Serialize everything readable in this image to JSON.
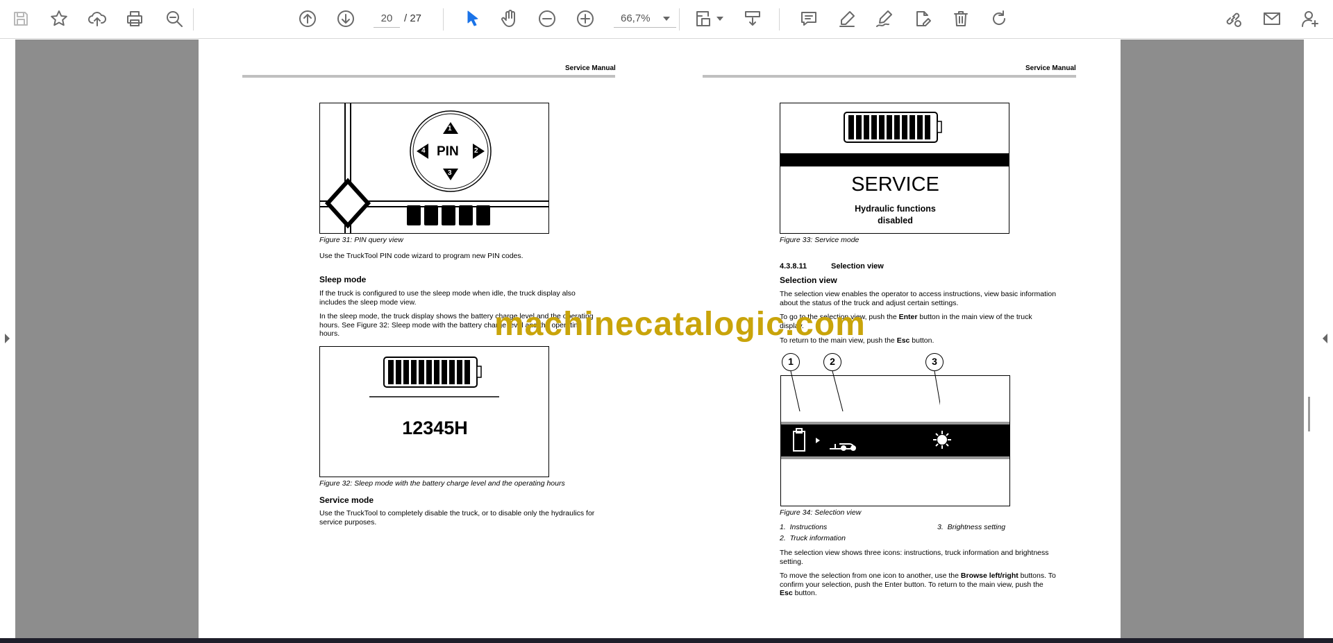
{
  "toolbar": {
    "page_current": "20",
    "page_total": "/  27",
    "zoom": "66,7%"
  },
  "watermark": "machinecatalogic.com",
  "left_page": {
    "header": "Service Manual",
    "fig31": {
      "pin": "PIN",
      "num1": "1",
      "num2": "2",
      "num3": "3",
      "num4": "4",
      "caption": "Figure 31: PIN query view"
    },
    "para1": "Use the TruckTool PIN code wizard to program new PIN codes.",
    "sleep_heading": "Sleep mode",
    "sleep_p1": "If the truck is configured to use the sleep mode when idle, the truck display also includes the sleep mode view.",
    "sleep_p2": "In the sleep mode, the truck display shows the battery charge level and the operating hours. See Figure 32: Sleep mode with the battery charge level and the operating hours.",
    "fig32": {
      "hours": "12345H",
      "caption": "Figure 32: Sleep mode with the battery charge level and the operating hours"
    },
    "service_heading": "Service mode",
    "service_p": "Use the TruckTool to completely disable the truck, or to disable only the hydraulics for service purposes."
  },
  "right_page": {
    "header": "Service Manual",
    "fig33": {
      "service": "SERVICE",
      "line1": "Hydraulic functions",
      "line2": "disabled",
      "caption": "Figure 33: Service mode"
    },
    "section_number": "4.3.8.11",
    "section_title": "Selection view",
    "sub_heading": "Selection view",
    "p1": "The selection view enables the operator to access instructions, view basic information about the status of the truck and adjust certain settings.",
    "p2_a": "To go to the selection view, push the ",
    "p2_b": "Enter",
    "p2_c": " button in the main view of the truck display.",
    "p3_a": "To return to the main view, push the ",
    "p3_b": "Esc",
    "p3_c": " button.",
    "callouts": [
      "1",
      "2",
      "3"
    ],
    "fig34_caption": "Figure 34: Selection view",
    "legend": [
      {
        "num": "1.",
        "text": "Instructions"
      },
      {
        "num": "2.",
        "text": "Truck information"
      },
      {
        "num": "3.",
        "text": "Brightness setting"
      }
    ],
    "p4": "The selection view shows three icons: instructions, truck information and brightness setting.",
    "p5_a": "To move the selection from one icon to another, use the ",
    "p5_b": "Browse left/right",
    "p5_c": " buttons. To confirm your selection, push the Enter button. To return to the main view, push the ",
    "p5_d": "Esc",
    "p5_e": " button."
  },
  "icons": [
    "save-icon",
    "star-icon",
    "upload-icon",
    "print-icon",
    "zoom-search-icon",
    "page-up-icon",
    "page-down-icon",
    "zoom-out-icon",
    "zoom-in-icon",
    "cursor-icon",
    "hand-icon",
    "fit-page-icon",
    "scroll-mode-icon",
    "comment-icon",
    "highlight-icon",
    "sign-icon",
    "edit-doc-icon",
    "delete-icon",
    "rotate-icon",
    "link-icon",
    "mail-icon",
    "add-user-icon"
  ]
}
